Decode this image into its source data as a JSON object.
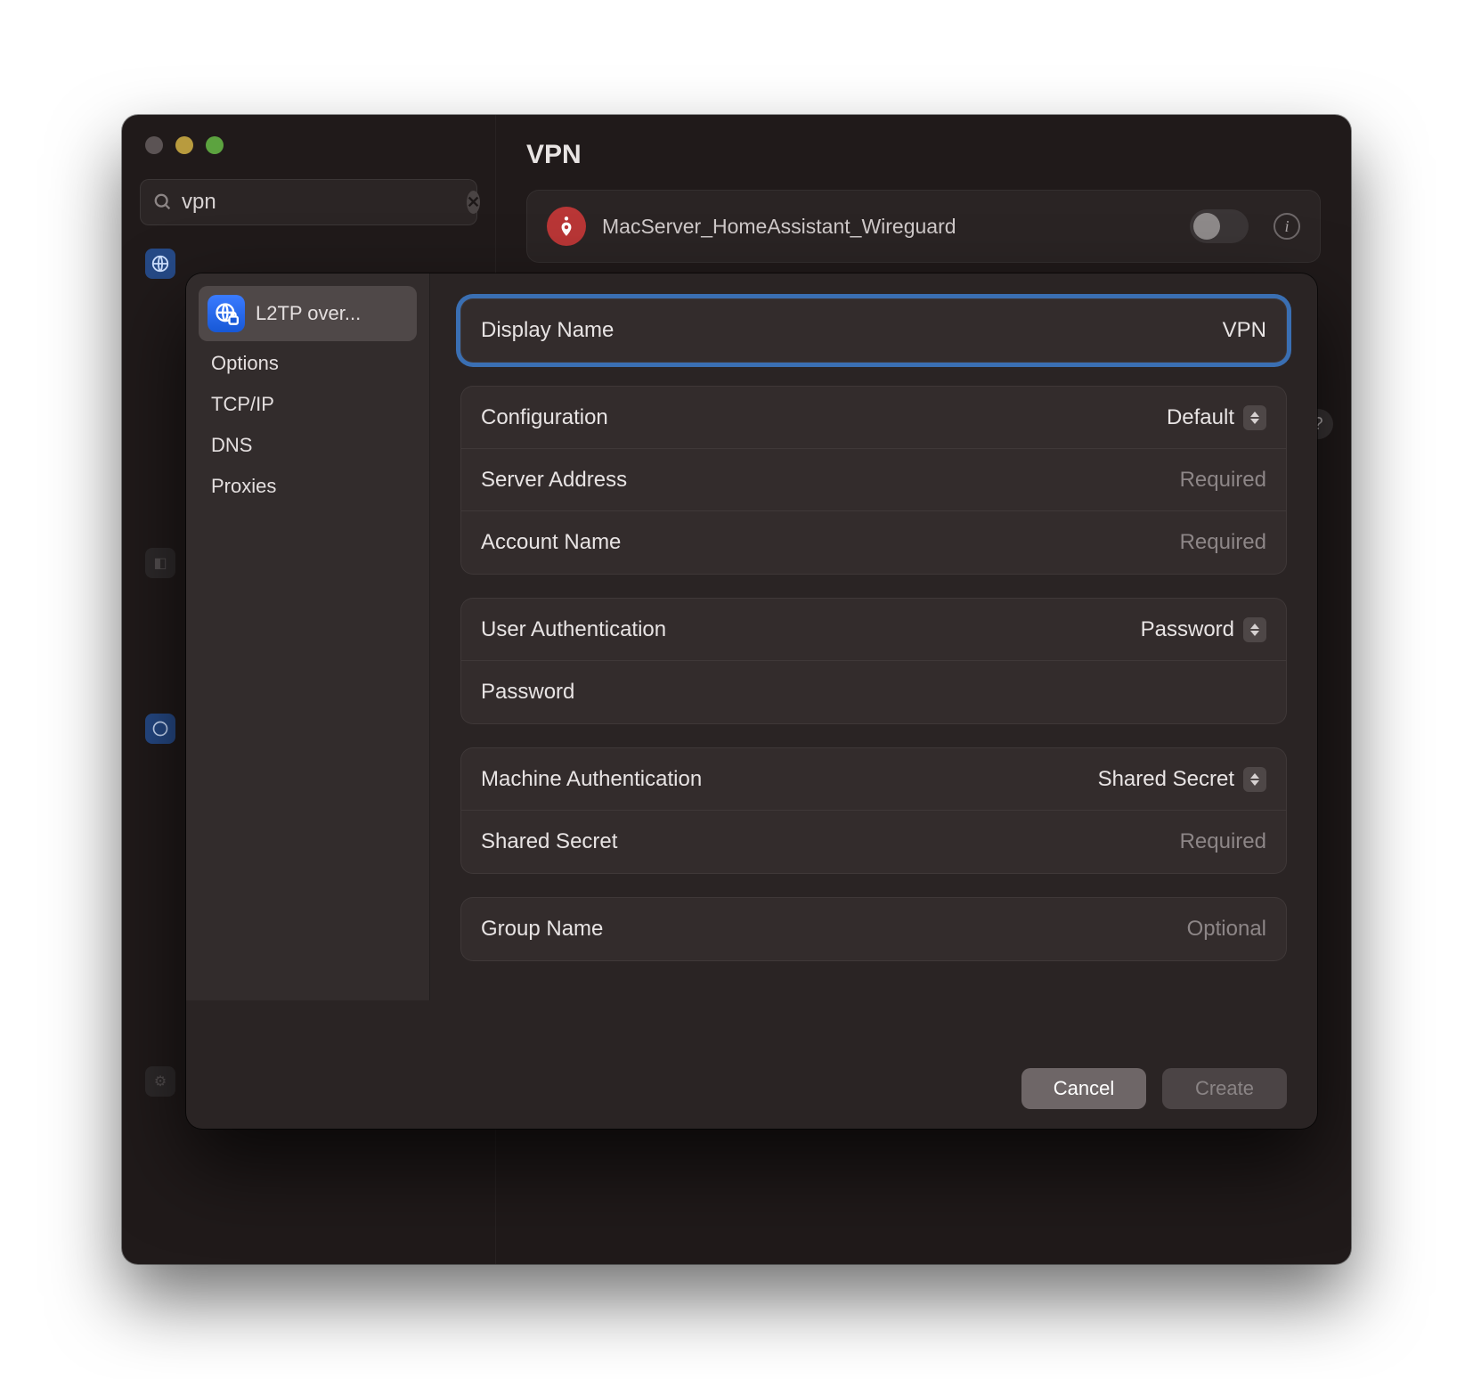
{
  "search": {
    "value": "vpn"
  },
  "page": {
    "title": "VPN"
  },
  "vpn_item": {
    "name": "MacServer_HomeAssistant_Wireguard"
  },
  "sheet": {
    "side": {
      "primary_label": "L2TP over...",
      "items": [
        "Options",
        "TCP/IP",
        "DNS",
        "Proxies"
      ]
    },
    "display_name": {
      "label": "Display Name",
      "value": "VPN"
    },
    "configuration": {
      "label": "Configuration",
      "value": "Default"
    },
    "server_address": {
      "label": "Server Address",
      "placeholder": "Required"
    },
    "account_name": {
      "label": "Account Name",
      "placeholder": "Required"
    },
    "user_auth": {
      "label": "User Authentication",
      "value": "Password"
    },
    "password": {
      "label": "Password"
    },
    "machine_auth": {
      "label": "Machine Authentication",
      "value": "Shared Secret"
    },
    "shared_secret": {
      "label": "Shared Secret",
      "placeholder": "Required"
    },
    "group_name": {
      "label": "Group Name",
      "placeholder": "Optional"
    },
    "buttons": {
      "cancel": "Cancel",
      "create": "Create"
    }
  }
}
